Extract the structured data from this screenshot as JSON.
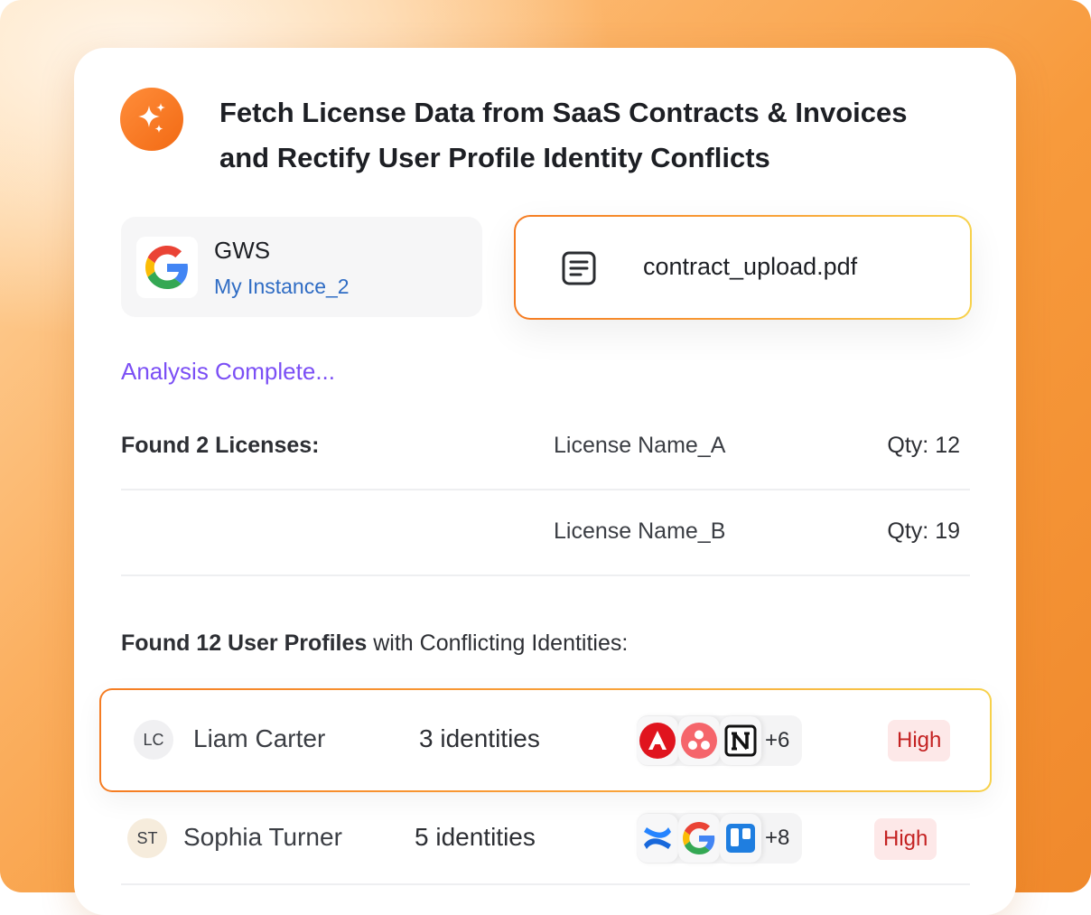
{
  "title": {
    "line1": "Fetch License Data from SaaS Contracts & Invoices",
    "line2": "and Rectify User Profile Identity Conflicts"
  },
  "source": {
    "name": "GWS",
    "instance": "My Instance_2",
    "icon": "google-icon"
  },
  "file": {
    "name": "contract_upload.pdf",
    "icon": "document-icon"
  },
  "status": "Analysis Complete...",
  "licenses": {
    "heading": "Found 2 Licenses:",
    "items": [
      {
        "name": "License Name_A",
        "qty": "Qty: 12"
      },
      {
        "name": "License Name_B",
        "qty": "Qty: 19"
      }
    ]
  },
  "profiles": {
    "heading_bold": "Found 12 User Profiles",
    "heading_rest": " with Conflicting Identities:",
    "users": [
      {
        "initials": "LC",
        "name": "Liam Carter",
        "identities": "3 identities",
        "apps": [
          "adobe-icon",
          "asana-icon",
          "notion-icon"
        ],
        "more": "+6",
        "risk": "High"
      },
      {
        "initials": "ST",
        "name": "Sophia Turner",
        "identities": "5 identities",
        "apps": [
          "confluence-icon",
          "google-icon",
          "trello-icon"
        ],
        "more": "+8",
        "risk": "High"
      }
    ]
  },
  "colors": {
    "accent_orange": "#f57c22",
    "status_purple": "#7b4ff5",
    "risk_red": "#c42222",
    "link_blue": "#2f6cc4"
  }
}
